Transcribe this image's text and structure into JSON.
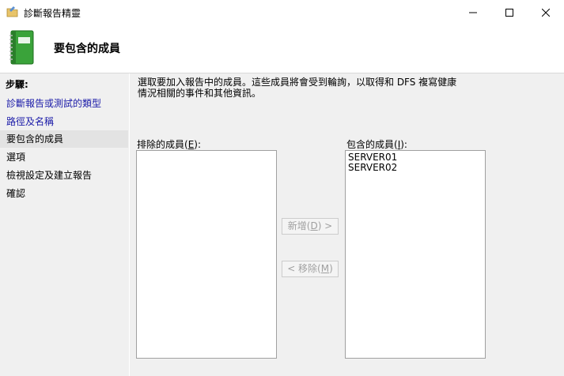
{
  "window": {
    "title": "診斷報告精靈",
    "icon": "wizard-folder-icon",
    "controls": [
      "minimize-icon",
      "maximize-icon",
      "close-icon"
    ]
  },
  "header": {
    "title": "要包含的成員",
    "icon": "green-book-icon"
  },
  "sidebar": {
    "heading": "步驟:",
    "items": [
      {
        "label": "診斷報告或測試的類型",
        "state": "link"
      },
      {
        "label": "路徑及名稱",
        "state": "link"
      },
      {
        "label": "要包含的成員",
        "state": "current"
      },
      {
        "label": "選項",
        "state": "plain"
      },
      {
        "label": "檢視設定及建立報告",
        "state": "plain"
      },
      {
        "label": "確認",
        "state": "plain"
      }
    ]
  },
  "main": {
    "description_line1": "選取要加入報告中的成員。這些成員將會受到輪詢，以取得和 DFS 複寫健康",
    "description_line2": "情況相關的事件和其他資訊。",
    "excluded": {
      "label_prefix": "排除的成員(",
      "label_key": "E",
      "label_suffix": "):",
      "items": []
    },
    "included": {
      "label_prefix": "包含的成員(",
      "label_key": "I",
      "label_suffix": "):",
      "items": [
        "SERVER01",
        "SERVER02"
      ]
    },
    "add_button": {
      "prefix": "新增(",
      "key": "D",
      "suffix": ") >",
      "enabled": false
    },
    "remove_button": {
      "prefix": "< 移除(",
      "key": "M",
      "suffix": ")",
      "enabled": false
    }
  }
}
